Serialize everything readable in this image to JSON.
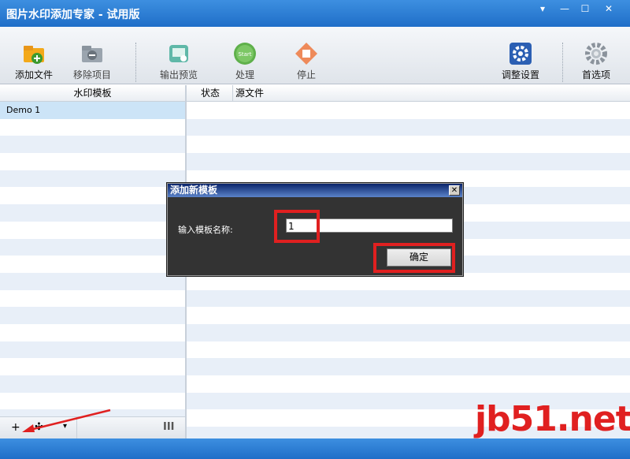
{
  "window": {
    "title": "图片水印添加专家 - 试用版",
    "btn_menu": "▾",
    "btn_min": "—",
    "btn_max": "☐",
    "btn_close": "✕"
  },
  "toolbar": {
    "add_file": "添加文件",
    "remove_item": "移除项目",
    "preview": "输出预览",
    "process": "处理",
    "stop": "停止",
    "settings": "调整设置",
    "options": "首选项"
  },
  "left_panel": {
    "header": "水印模板",
    "items": [
      "Demo 1"
    ],
    "footer": {
      "add": "+",
      "move": "✣",
      "dropdown": "▾",
      "columns": "III"
    }
  },
  "right_panel": {
    "col_status": "状态",
    "col_source": "源文件"
  },
  "dialog": {
    "title": "添加新模板",
    "close": "✕",
    "label": "输入模板名称:",
    "input_value": "1",
    "ok_button": "确定"
  },
  "watermark": "jb51.net",
  "colors": {
    "accent": "#1f6ec8",
    "highlight": "#e02020"
  }
}
